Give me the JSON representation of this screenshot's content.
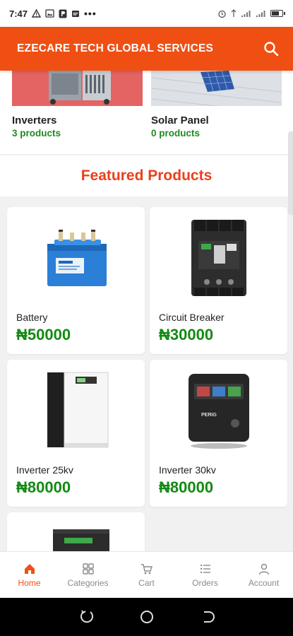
{
  "status_bar": {
    "time": "7:47"
  },
  "app_bar": {
    "title": "EZECARE TECH GLOBAL SERVICES"
  },
  "categories": [
    {
      "name": "Inverters",
      "count": "3 products"
    },
    {
      "name": "Solar Panel",
      "count": "0 products"
    }
  ],
  "featured": {
    "title": "Featured Products",
    "products": [
      {
        "name": "Battery",
        "price": "₦50000"
      },
      {
        "name": "Circuit Breaker",
        "price": "₦30000"
      },
      {
        "name": "Inverter 25kv",
        "price": "₦80000"
      },
      {
        "name": "Inverter 30kv",
        "price": "₦80000"
      }
    ]
  },
  "bottom_nav": [
    {
      "label": "Home",
      "icon": "home-icon",
      "active": true
    },
    {
      "label": "Categories",
      "icon": "grid-icon",
      "active": false
    },
    {
      "label": "Cart",
      "icon": "cart-icon",
      "active": false
    },
    {
      "label": "Orders",
      "icon": "list-icon",
      "active": false
    },
    {
      "label": "Account",
      "icon": "person-icon",
      "active": false
    }
  ],
  "colors": {
    "primary": "#f04f14",
    "accent_title": "#e8401c",
    "price_green": "#128a12",
    "count_green": "#1e8a1e"
  }
}
